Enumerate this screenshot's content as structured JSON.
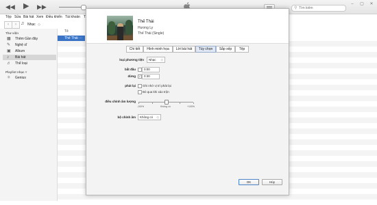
{
  "toolbar": {
    "rewind_icon": "◀◀",
    "play_icon": "▶",
    "forward_icon": "▶▶",
    "list_view_icon": "list-icon",
    "search_placeholder": "Tìm kiếm",
    "search_icon": "⚲"
  },
  "menu": [
    "Tệp",
    "Sửa",
    "Bài hát",
    "Xem",
    "Điều khiển",
    "Tài khoản",
    "T"
  ],
  "nav": {
    "back": "‹",
    "forward": "›",
    "library_icon": "♫",
    "library_label": "Nhạc",
    "library_caret": "◇"
  },
  "sidebar": {
    "library_header": "Thư viện",
    "items": [
      {
        "label": "Thêm Gần đây",
        "icon": "▦"
      },
      {
        "label": "Nghệ sĩ",
        "icon": "✎"
      },
      {
        "label": "Album",
        "icon": "▣"
      },
      {
        "label": "Bài hát",
        "icon": "♪"
      },
      {
        "label": "Thể loại",
        "icon": "♬"
      }
    ],
    "playlists_header": "Playlist nhạc ˅",
    "playlist_items": [
      {
        "label": "Genius",
        "icon": "⚛"
      }
    ]
  },
  "list": {
    "column_header": "Tê",
    "selected_row": "Thế Thái ···"
  },
  "dialog": {
    "song_title": "Thế Thái",
    "artist": "Hương Ly",
    "album": "Thế Thái (Single)",
    "tabs": [
      "Chi tiết",
      "Hình minh họa",
      "Lời bài hát",
      "Tùy chọn",
      "Sắp xếp",
      "Tệp"
    ],
    "active_tab": "Tùy chọn",
    "media_kind_label": "loại phương tiện",
    "media_kind_value": "Nhạc",
    "dropdown_caret": "◇",
    "start_label": "bắt đầu",
    "start_checked": false,
    "start_value": "0:00",
    "stop_label": "dừng",
    "stop_checked": true,
    "stop_value": "0:30",
    "playback_label": "phát lại",
    "remember_position": "Ghi nhớ vị trí phát lại",
    "skip_shuffle": "Bỏ qua khi xáo trộn",
    "volume_label": "điều chỉnh âm lượng",
    "volume_min": "-100%",
    "volume_mid": "Không có",
    "volume_max": "+100%",
    "volume_level": 0.5,
    "eq_label": "bộ chỉnh âm",
    "eq_value": "Không có",
    "ok_label": "OK",
    "cancel_label": "Hủy"
  },
  "colors": {
    "selection": "#3b73c4",
    "dialog_bg": "#f3f3f3"
  }
}
